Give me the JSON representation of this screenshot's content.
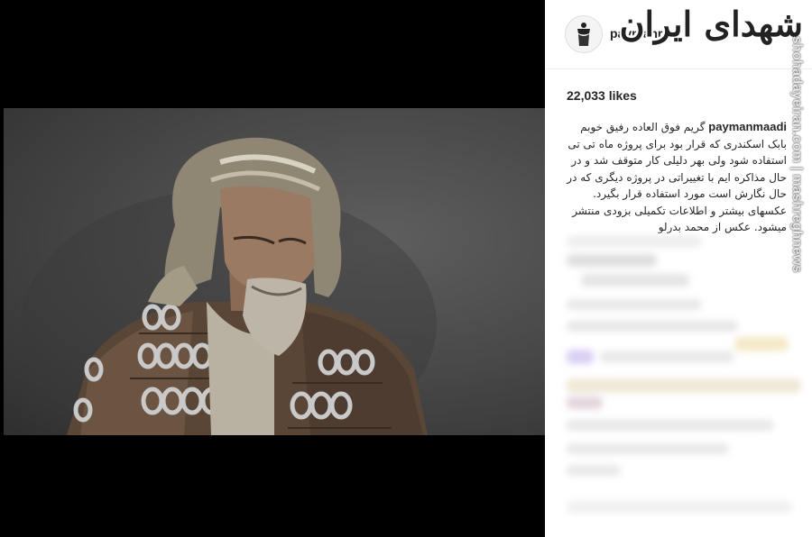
{
  "post": {
    "username": "paymanr",
    "likes": "22,033 likes",
    "caption_user": "paymanmaadi",
    "caption_text": "گریم فوق العاده رفیق خوبم بابک اسکندری که قرار بود برای پروژه ماه تی تی استفاده شود ولی بهر دلیلی کار متوقف شد و در حال مذاکره ایم با تغییراتی در پروژه دیگری که در حال نگارش است مورد استفاده قرار بگیرد. عکسهای بیشتر و اطلاعات تکمیلی بزودی منتشر میشود. عکس از محمد بدرلو"
  },
  "watermark": {
    "logo_text": "شهدای ایران",
    "site_text": "shohadayeiran.com | mashreghnews"
  },
  "colors": {
    "media_bg": "#000000",
    "text": "#262626",
    "divider": "#efefef"
  },
  "icons": [
    "avatar-icon"
  ]
}
